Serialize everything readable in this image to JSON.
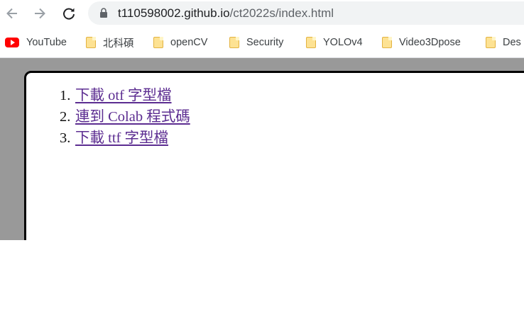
{
  "browser": {
    "url_host": "t110598002.github.io",
    "url_path": "/ct2022s/index.html"
  },
  "bookmarks": [
    {
      "label": "YouTube",
      "icon": "youtube-icon"
    },
    {
      "label": "北科碩",
      "icon": "folder-icon"
    },
    {
      "label": "openCV",
      "icon": "folder-icon"
    },
    {
      "label": "Security",
      "icon": "folder-icon"
    },
    {
      "label": "YOLOv4",
      "icon": "folder-icon"
    },
    {
      "label": "Video3Dpose",
      "icon": "folder-icon"
    },
    {
      "label": "Des",
      "icon": "folder-icon"
    }
  ],
  "page": {
    "links": [
      {
        "num": "1.",
        "label": "下載 otf 字型檔"
      },
      {
        "num": "2.",
        "label": "連到 Colab 程式碼"
      },
      {
        "num": "3.",
        "label": "下載 ttf 字型檔"
      }
    ]
  },
  "colors": {
    "link_visited": "#5c2d91",
    "page_background": "#999999",
    "card_border": "#000000",
    "omnibox": "#f1f3f4"
  }
}
